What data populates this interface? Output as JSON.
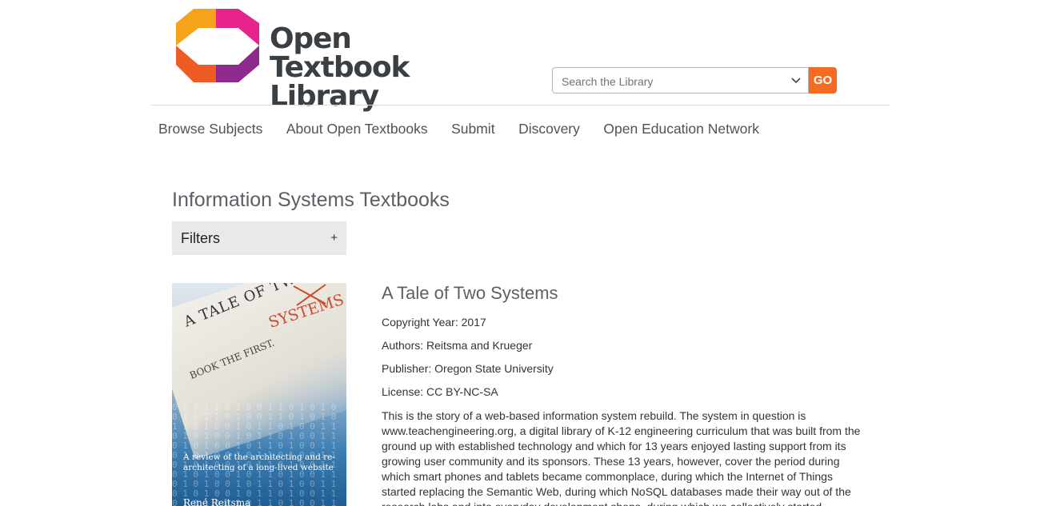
{
  "header": {
    "logo_line1": "Open Textbook",
    "logo_line2": "Library",
    "search_placeholder": "Search the Library",
    "go_label": "GO",
    "accent_color": "#f46b21"
  },
  "nav": [
    {
      "label": "Browse Subjects"
    },
    {
      "label": "About Open Textbooks"
    },
    {
      "label": "Submit"
    },
    {
      "label": "Discovery"
    },
    {
      "label": "Open Education Network"
    }
  ],
  "page": {
    "title": "Information Systems Textbooks",
    "filters_label": "Filters",
    "filters_toggle": "+"
  },
  "book": {
    "cover": {
      "line1": "A TALE OF TWO CITIES",
      "line2": "SYSTEMS",
      "line3": "BOOK THE FIRST.",
      "subtitle": "A review of the architecting and re-architecting of a long-lived website",
      "author": "René Reitsma"
    },
    "title": "A Tale of Two Systems",
    "copyright": "Copyright Year: 2017",
    "authors": "Authors: Reitsma and Krueger",
    "publisher": "Publisher: Oregon State University",
    "license": "License: CC BY-NC-SA",
    "description": "This is the story of a web-based information system rebuild. The system in question is www.teachengineering.org, a digital library of K-12 engineering curriculum that was built from the ground up with established technology and which for 13 years enjoyed lasting support from its growing user community and its sponsors. These 13 years, however, cover the period during which smart phones and tablets became commonplace, during which the Internet of Things started replacing the Semantic Web, during which NoSQL databases made their way out of the research labs and into everyday development shops, during which we collectively started"
  }
}
